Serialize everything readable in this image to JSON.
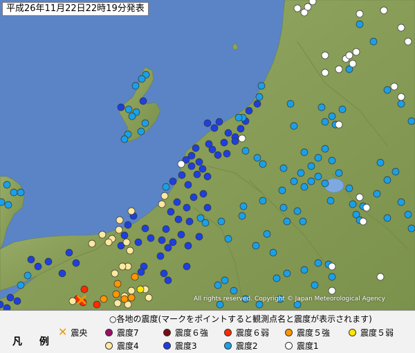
{
  "title": "平成26年11月22日22時19分発表",
  "copyright": "All rights reserved. Copyright © Japan Meteorological Agency",
  "legend": {
    "heading": "凡 例",
    "note": "○各地の震度(マークをポイントすると観測点名と震度が表示されます)",
    "epicenter_label": "震央",
    "epicenter_color": "#f39400",
    "items": [
      {
        "label": "震度7",
        "color": "#9c0d66"
      },
      {
        "label": "震度６強",
        "color": "#7a0b12"
      },
      {
        "label": "震度６弱",
        "color": "#ff2a00"
      },
      {
        "label": "震度５強",
        "color": "#ff9600"
      },
      {
        "label": "震度５弱",
        "color": "#ffe600"
      },
      {
        "label": "震度4",
        "color": "#ffe8a0"
      },
      {
        "label": "震度3",
        "color": "#1e3fe0"
      },
      {
        "label": "震度2",
        "color": "#1aa0e8"
      },
      {
        "label": "震度1",
        "color": "#ffffff"
      }
    ]
  },
  "colors": {
    "sea": "#5a84c6",
    "land": "#8ea35e",
    "land_dark": "#6f8748",
    "lake": "#7ea8e0"
  }
}
